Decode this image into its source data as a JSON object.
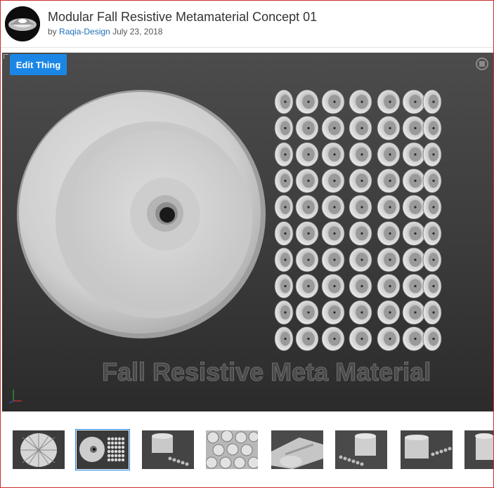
{
  "header": {
    "title": "Modular Fall Resistive Metamaterial Concept 01",
    "by_prefix": "by",
    "author": "Raqia-Design",
    "date": "July 23, 2018"
  },
  "viewer": {
    "edit_button_label": "Edit Thing",
    "watermark": "Fall Resistive Meta Material",
    "fullscreen_icon": "fullscreen-icon"
  },
  "thumbnails": {
    "count": 8,
    "selected_index": 1
  },
  "colors": {
    "accent": "#1a87e6",
    "frame_border": "#c9302c",
    "author_link": "#1e6fb8"
  }
}
